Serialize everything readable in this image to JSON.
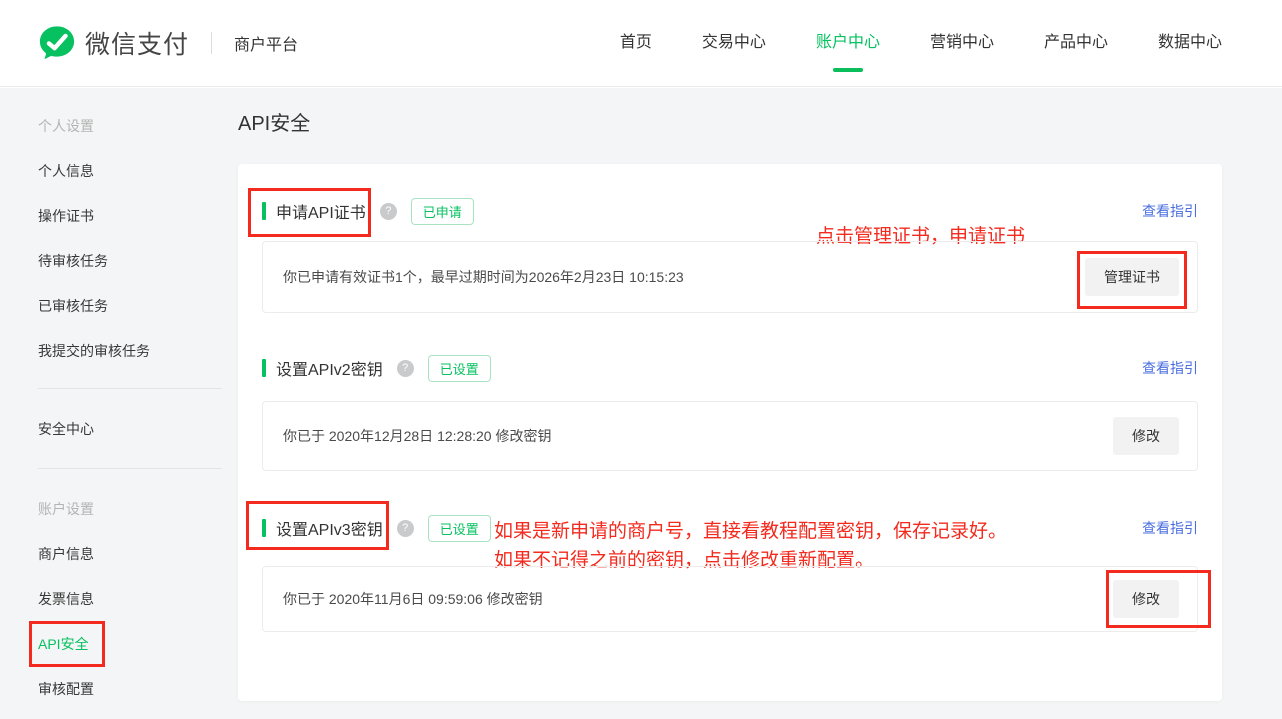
{
  "header": {
    "logo_text": "微信支付",
    "portal_label": "商户平台",
    "nav": [
      {
        "label": "首页",
        "active": false
      },
      {
        "label": "交易中心",
        "active": false
      },
      {
        "label": "账户中心",
        "active": true
      },
      {
        "label": "营销中心",
        "active": false
      },
      {
        "label": "产品中心",
        "active": false
      },
      {
        "label": "数据中心",
        "active": false
      }
    ]
  },
  "sidebar": {
    "groups": [
      {
        "header": "个人设置",
        "items": [
          "个人信息",
          "操作证书",
          "待审核任务",
          "已审核任务",
          "我提交的审核任务"
        ]
      },
      {
        "header": "",
        "items": [
          "安全中心"
        ]
      },
      {
        "header": "账户设置",
        "items": [
          "商户信息",
          "发票信息",
          "API安全",
          "审核配置"
        ]
      }
    ],
    "active_item": "API安全"
  },
  "main": {
    "page_title": "API安全",
    "sections": [
      {
        "title": "申请API证书",
        "help_icon": "question-mark",
        "badge": "已申请",
        "guide_link": "查看指引",
        "content": "你已申请有效证书1个，最早过期时间为2026年2月23日 10:15:23",
        "button": "管理证书"
      },
      {
        "title": "设置APIv2密钥",
        "help_icon": "question-mark",
        "badge": "已设置",
        "guide_link": "查看指引",
        "content": "你已于 2020年12月28日 12:28:20 修改密钥",
        "button": "修改"
      },
      {
        "title": "设置APIv3密钥",
        "help_icon": "question-mark",
        "badge": "已设置",
        "guide_link": "查看指引",
        "content": "你已于 2020年11月6日 09:59:06 修改密钥",
        "button": "修改"
      }
    ]
  },
  "annotations": {
    "cert_note": "点击管理证书，申请证书",
    "apiv3_note_line1": "如果是新申请的商户号，直接看教程配置密钥，保存记录好。",
    "apiv3_note_line2": "如果不记得之前的密钥，点击修改重新配置。"
  },
  "colors": {
    "brand_green": "#07c160",
    "link_blue": "#4a6ee0",
    "annotation_red": "#f32a1d"
  }
}
